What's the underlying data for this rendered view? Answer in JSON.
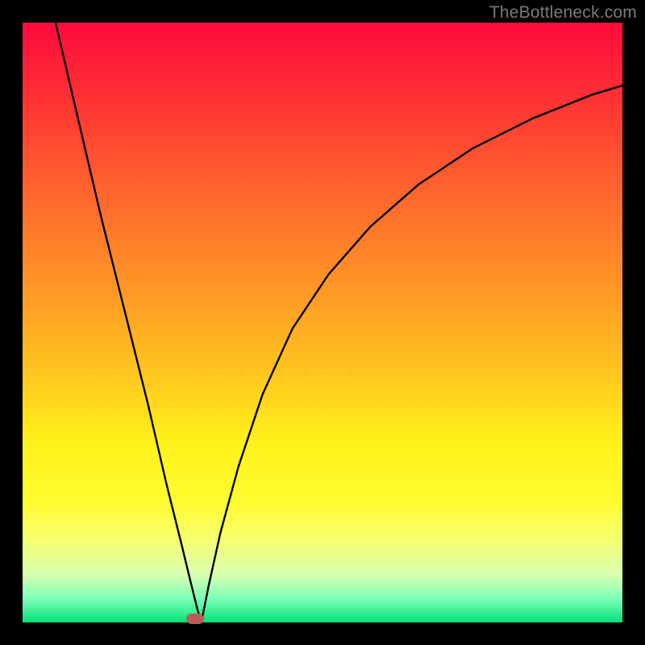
{
  "watermark": "TheBottleneck.com",
  "marker": {
    "x_frac": 0.288,
    "y_frac": 0.993
  },
  "chart_data": {
    "type": "line",
    "title": "",
    "xlabel": "",
    "ylabel": "",
    "xlim": [
      0,
      1
    ],
    "ylim": [
      0,
      1
    ],
    "series": [
      {
        "name": "left-branch",
        "x": [
          0.055,
          0.09,
          0.13,
          0.17,
          0.21,
          0.24,
          0.265,
          0.282,
          0.292,
          0.298
        ],
        "y": [
          1.0,
          0.85,
          0.68,
          0.52,
          0.36,
          0.23,
          0.13,
          0.06,
          0.02,
          0.0
        ]
      },
      {
        "name": "right-branch",
        "x": [
          0.298,
          0.31,
          0.33,
          0.36,
          0.4,
          0.45,
          0.51,
          0.58,
          0.66,
          0.75,
          0.85,
          0.95,
          1.0
        ],
        "y": [
          0.0,
          0.06,
          0.15,
          0.26,
          0.38,
          0.49,
          0.58,
          0.66,
          0.73,
          0.79,
          0.84,
          0.88,
          0.895
        ]
      }
    ],
    "annotations": [
      {
        "name": "min-marker",
        "x": 0.288,
        "y": 0.007,
        "shape": "rounded-rect",
        "color": "#bb5b5a"
      }
    ],
    "background": {
      "type": "vertical-gradient",
      "stops": [
        {
          "pos": 0.0,
          "color": "#ff0b3d"
        },
        {
          "pos": 0.3,
          "color": "#ff6a2c"
        },
        {
          "pos": 0.58,
          "color": "#ffc41f"
        },
        {
          "pos": 0.8,
          "color": "#fffc30"
        },
        {
          "pos": 0.96,
          "color": "#7dffb8"
        },
        {
          "pos": 1.0,
          "color": "#05e27b"
        }
      ]
    }
  }
}
